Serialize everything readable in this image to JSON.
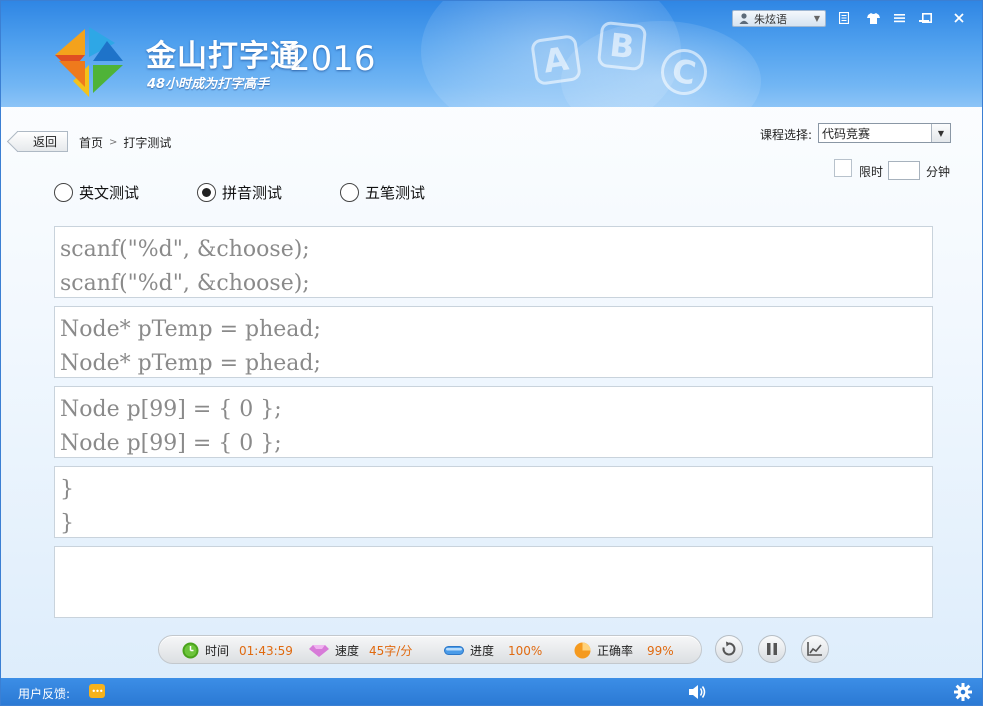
{
  "app": {
    "title": "金山打字通",
    "year": "2016",
    "slogan": "48小时成为打字高手",
    "abc_blocks": [
      "A",
      "B",
      "C"
    ]
  },
  "titlebar": {
    "user_name": "朱炫语",
    "icons": [
      "user-icon",
      "doc-icon",
      "shirt-icon",
      "menu-icon",
      "minimize-icon",
      "maximize-icon",
      "close-icon"
    ]
  },
  "nav": {
    "back_label": "返回",
    "breadcrumb": [
      "首页",
      "打字测试"
    ],
    "separator": ">"
  },
  "course": {
    "label": "课程选择:",
    "selected": "代码竞赛"
  },
  "time_limit": {
    "label": "限时",
    "value": "",
    "unit": "分钟",
    "checked": false
  },
  "modes": [
    {
      "label": "英文测试",
      "selected": false
    },
    {
      "label": "拼音测试",
      "selected": true
    },
    {
      "label": "五笔测试",
      "selected": false
    }
  ],
  "panels": [
    {
      "source": "scanf(\"%d\", &choose);",
      "typed": "scanf(\"%d\", &choose);"
    },
    {
      "source": "Node* pTemp = phead;",
      "typed": "Node* pTemp = phead;"
    },
    {
      "source": "Node p[99] = { 0 };",
      "typed": "Node p[99] = { 0 };"
    },
    {
      "source": "}",
      "typed": "}"
    },
    {
      "source": "",
      "typed": ""
    }
  ],
  "stats": {
    "time_label": "时间",
    "time_value": "01:43:59",
    "speed_label": "速度",
    "speed_value": "45字/分",
    "progress_label": "进度",
    "progress_value": "100%",
    "accuracy_label": "正确率",
    "accuracy_value": "99%"
  },
  "footer": {
    "feedback_label": "用户反馈:"
  },
  "colors": {
    "header_blue": "#4fa0ee",
    "stat_value_orange": "#e06a10",
    "bottom_bar_blue": "#2a78d3"
  }
}
